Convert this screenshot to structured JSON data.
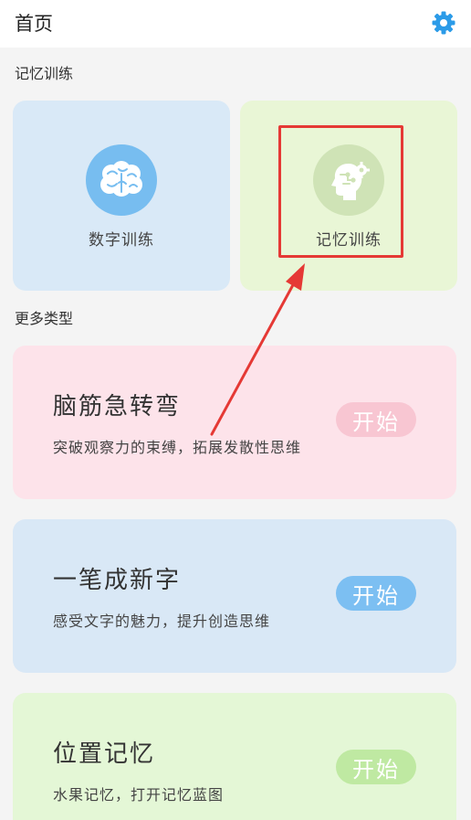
{
  "header": {
    "title": "首页",
    "settings_icon": "gear-icon"
  },
  "memory_section": {
    "label": "记忆训练",
    "cards": [
      {
        "label": "数字训练",
        "icon": "brain-icon"
      },
      {
        "label": "记忆训练",
        "icon": "head-gear-icon"
      }
    ]
  },
  "more_section": {
    "label": "更多类型",
    "cards": [
      {
        "title": "脑筋急转弯",
        "subtitle": "突破观察力的束缚，拓展发散性思维",
        "button": "开始"
      },
      {
        "title": "一笔成新字",
        "subtitle": "感受文字的魅力，提升创造思维",
        "button": "开始"
      },
      {
        "title": "位置记忆",
        "subtitle": "水果记忆，打开记忆蓝图",
        "button": "开始"
      }
    ]
  },
  "colors": {
    "accent": "#2b9be8",
    "annotation": "#e53935"
  }
}
